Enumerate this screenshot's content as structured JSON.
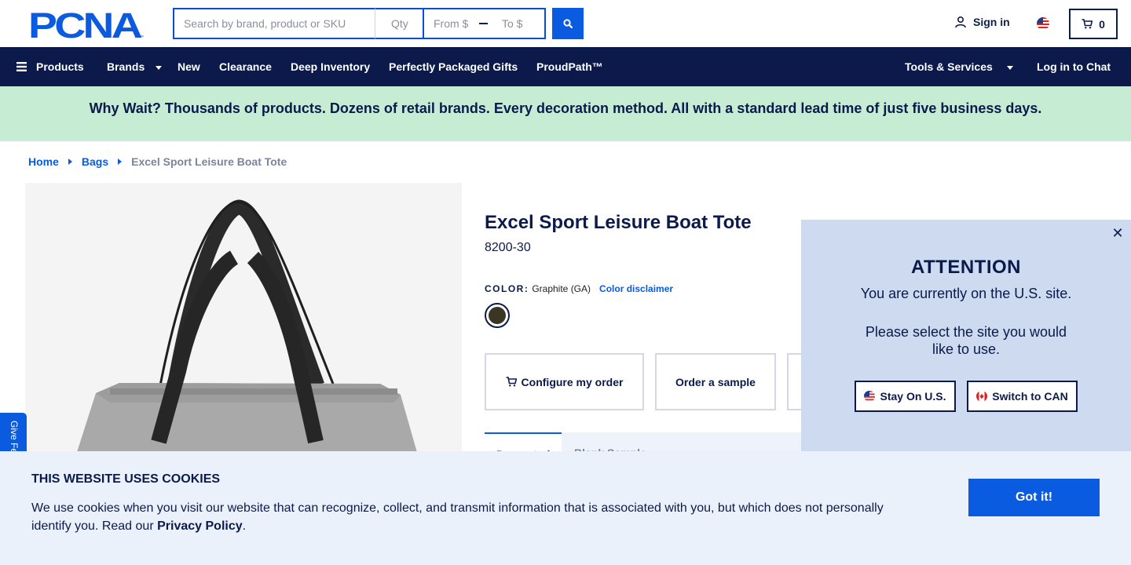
{
  "header": {
    "logo_text": "PCNA",
    "search_placeholder": "Search by brand, product or SKU",
    "qty_placeholder": "Qty",
    "price_from_placeholder": "From $",
    "price_to_placeholder": "To $",
    "signin_label": "Sign in",
    "cart_count": "0"
  },
  "nav": {
    "products": "Products",
    "brands": "Brands",
    "new": "New",
    "clearance": "Clearance",
    "deep_inventory": "Deep Inventory",
    "packaged_gifts": "Perfectly Packaged Gifts",
    "proudpath": "ProudPath™",
    "tools_services": "Tools & Services",
    "chat": "Log in to Chat"
  },
  "banner": {
    "text": "Why Wait? Thousands of products. Dozens of retail brands. Every decoration method. All with a standard lead time of just five business days."
  },
  "breadcrumb": {
    "home": "Home",
    "category": "Bags",
    "current": "Excel Sport Leisure Boat Tote"
  },
  "product": {
    "title": "Excel Sport Leisure Boat Tote",
    "sku": "8200-30",
    "color_label": "COLOR:",
    "color_value": "Graphite (GA)",
    "color_disclaimer": "Color disclaimer",
    "swatch_color": "#3b3623",
    "configure_label": "Configure my order",
    "sample_label": "Order a sample",
    "tab_active": "Decorated",
    "tab_other": "Blank Sample"
  },
  "popup": {
    "title": "ATTENTION",
    "line1": "You are currently on the U.S. site.",
    "line2": "Please select the site you would",
    "line3": "like to use.",
    "stay_label": "Stay On U.S.",
    "switch_label": "Switch to CAN"
  },
  "feedback": {
    "label": "Give Feedback"
  },
  "cookies": {
    "title": "THIS WEBSITE USES COOKIES",
    "text_before": "We use cookies when you visit our website that can recognize, collect, and transmit information that is associated with you, but which does not personally identify you. Read our",
    "policy_link": "Privacy Policy",
    "text_after": ".",
    "got_it": "Got it!"
  },
  "colors": {
    "navy": "#0b1a4b",
    "accent_blue": "#0b5be0",
    "banner_green": "#c6ecd4",
    "popup_bg": "#cddaef",
    "cookie_bg": "#eaf1fb"
  }
}
